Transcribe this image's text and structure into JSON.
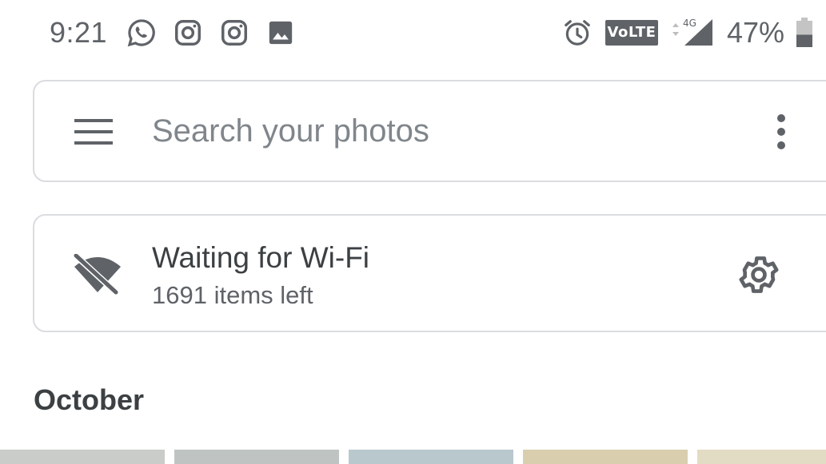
{
  "status_bar": {
    "time": "9:21",
    "notification_icons": [
      "whatsapp-icon",
      "instagram-icon",
      "instagram-icon",
      "image-icon"
    ],
    "alarm_icon": "alarm-icon",
    "volte_label": "VoLTE",
    "network_label": "4G",
    "battery_percent": "47%",
    "battery_level": 0.47
  },
  "search": {
    "menu_icon": "menu-icon",
    "placeholder": "Search your photos",
    "more_icon": "more-vert-icon"
  },
  "backup_status": {
    "icon": "wifi-off-icon",
    "title": "Waiting for Wi-Fi",
    "subtitle": "1691 items left",
    "settings_icon": "gear-icon"
  },
  "gallery": {
    "section_title": "October",
    "thumbnail_colors": [
      "#c9ccc8",
      "#bfc4c2",
      "#b9c8cc",
      "#d9cfae",
      "#e3dcc4"
    ]
  },
  "colors": {
    "text_primary": "#3c4043",
    "text_secondary": "#5f6368",
    "placeholder": "#80868b",
    "card_border": "#dadce0"
  }
}
